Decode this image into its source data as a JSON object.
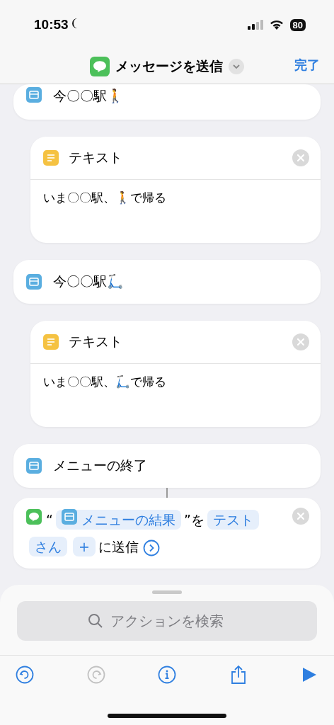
{
  "status_bar": {
    "time": "10:53",
    "battery": "80"
  },
  "nav": {
    "title": "メッセージを送信",
    "done": "完了"
  },
  "actions": [
    {
      "kind": "menu_item",
      "label": "今〇〇駅🚶"
    },
    {
      "kind": "text",
      "title": "テキスト",
      "body": "いま〇〇駅、🚶で帰る"
    },
    {
      "kind": "menu_item",
      "label": "今〇〇駅🛴"
    },
    {
      "kind": "text",
      "title": "テキスト",
      "body": "いま〇〇駅、🛴で帰る"
    },
    {
      "kind": "menu_end",
      "label": "メニューの終了"
    },
    {
      "kind": "send",
      "open_quote": "“",
      "variable": "メニューの結果",
      "close_quote": "”を",
      "recipient": "テストさん",
      "add": "+",
      "suffix": "に送信"
    }
  ],
  "search": {
    "placeholder": "アクションを検索"
  },
  "toolbar": [
    {
      "kind": "undo",
      "disabled": false
    },
    {
      "kind": "redo",
      "disabled": true
    },
    {
      "kind": "info",
      "disabled": false
    },
    {
      "kind": "share",
      "disabled": false
    },
    {
      "kind": "run",
      "disabled": false
    }
  ]
}
